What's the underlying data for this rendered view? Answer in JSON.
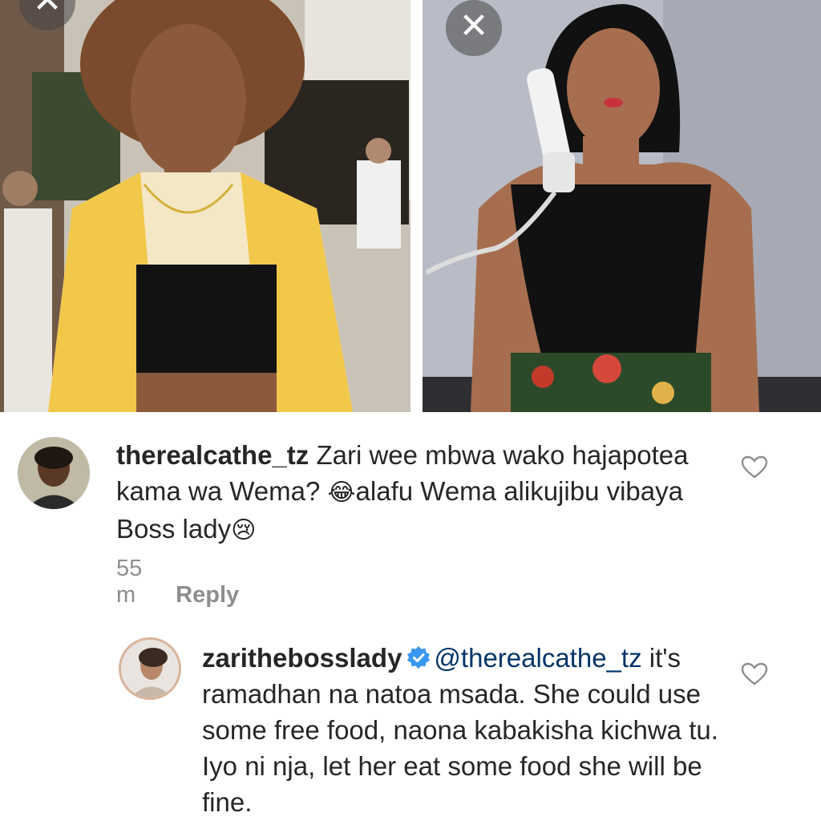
{
  "images": {
    "left": {
      "close_icon": "close-icon",
      "accent": "#f2c84b"
    },
    "right": {
      "close_icon": "close-icon",
      "accent": "#111111"
    }
  },
  "comments": [
    {
      "username": "therealcathe_tz",
      "text_parts": [
        "Zari wee mbwa wako hajapotea kama wa Wema? ",
        "😂",
        "alafu Wema alikujibu vibaya Boss lady",
        "😢"
      ],
      "time": "55 m",
      "reply_label": "Reply",
      "like_icon": "heart-icon"
    },
    {
      "username": "zarithebosslady",
      "verified": true,
      "mention": "@therealcathe_tz",
      "text": "it's ramadhan na natoa msada. She could use some free food, naona kabakisha kichwa tu. Iyo ni nja, let her eat some food she will be fine.",
      "like_icon": "heart-icon"
    }
  ],
  "colors": {
    "text": "#262626",
    "meta": "#8e8e8e",
    "verified": "#3897f0",
    "mention": "#003569"
  }
}
